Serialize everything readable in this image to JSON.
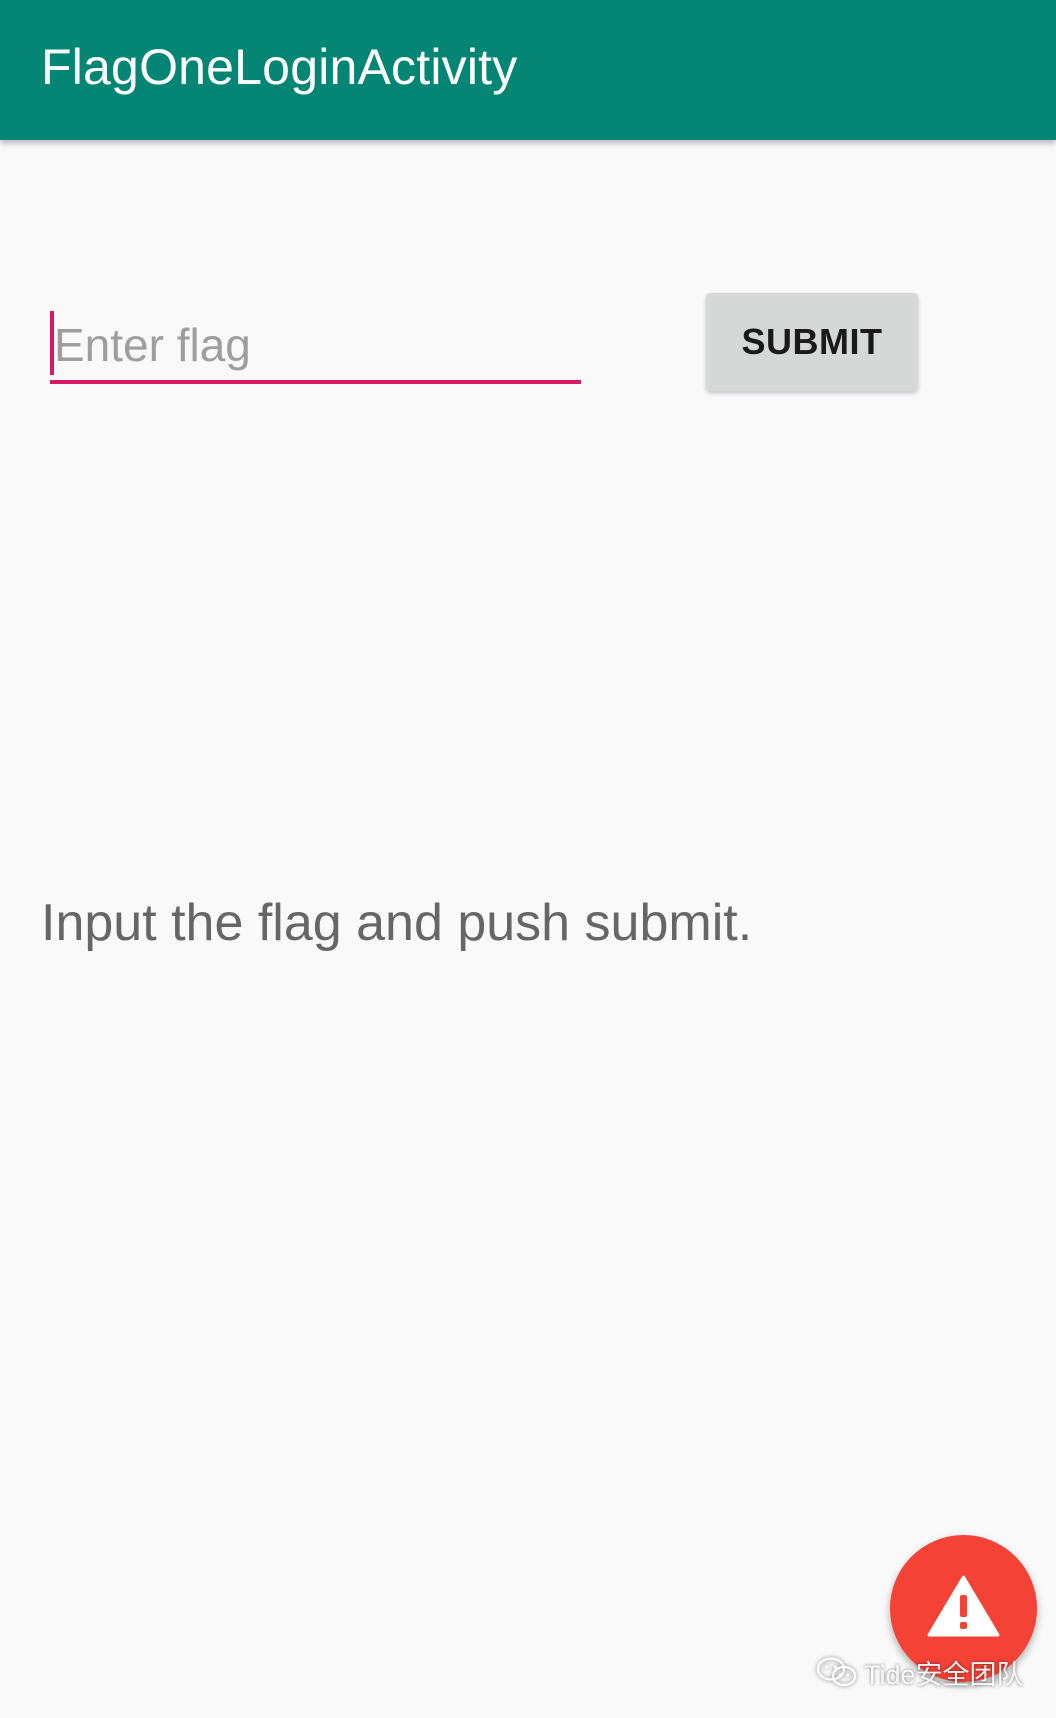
{
  "app_bar": {
    "title": "FlagOneLoginActivity",
    "color": "#058574"
  },
  "form": {
    "flag_input": {
      "placeholder": "Enter flag",
      "value": ""
    },
    "submit_label": "SUBMIT",
    "accent_color": "#d81b60"
  },
  "status": {
    "message": "Input the flag and push submit."
  },
  "fab": {
    "icon": "warning-icon",
    "color": "#f44336"
  },
  "watermark": {
    "icon": "wechat-icon",
    "text": "Tide安全团队"
  }
}
